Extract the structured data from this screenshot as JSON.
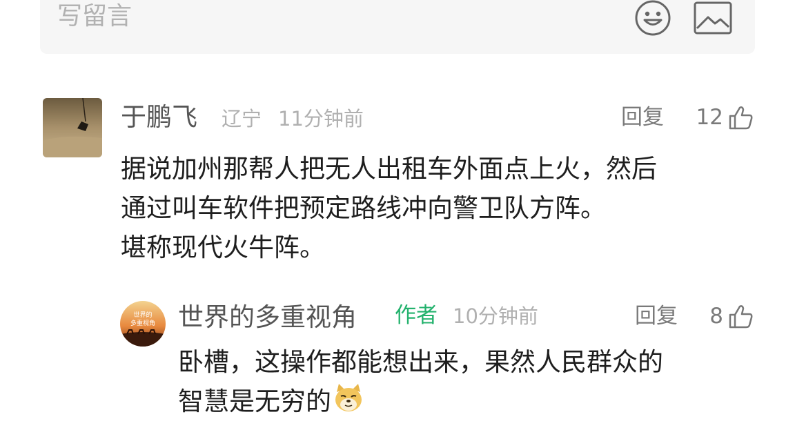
{
  "compose": {
    "placeholder": "写留言",
    "emoji_icon": "smiley-face-icon",
    "image_icon": "image-icon"
  },
  "comment": {
    "author": "于鹏飞",
    "location": "辽宁",
    "time": "11分钟前",
    "reply_label": "回复",
    "like_count": "12",
    "lines": [
      "据说加州那帮人把无人出租车外面点上火，然后",
      "通过叫车软件把预定路线冲向警卫队方阵。",
      "堪称现代火牛阵。"
    ]
  },
  "reply": {
    "author": "世界的多重视角",
    "badge": "作者",
    "time": "10分钟前",
    "reply_label": "回复",
    "like_count": "8",
    "avatar_text": [
      "世界的",
      "多重视角"
    ],
    "lines": [
      "卧槽，这操作都能想出来，果然人民群众的",
      "智慧是无穷的"
    ],
    "trailing_emoji": "doge-emoji-icon"
  }
}
